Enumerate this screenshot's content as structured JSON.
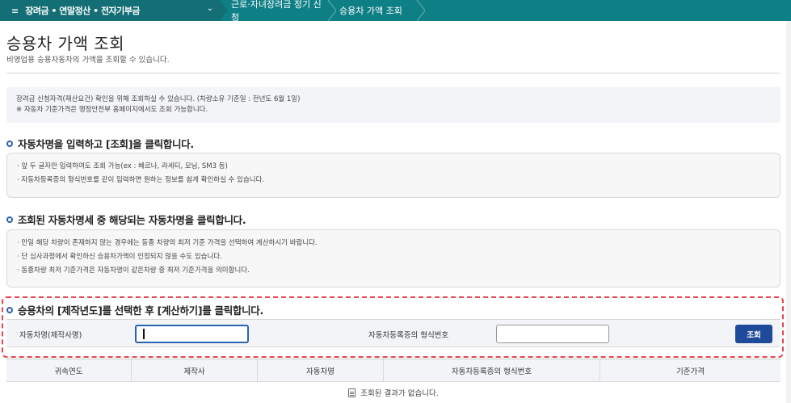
{
  "nav": {
    "menu_title": "장려금 • 연말정산 • 전자기부금",
    "menu_icon": "≡",
    "chevron": "⌄",
    "breadcrumbs": [
      "근로·자녀장려금 정기 신청",
      "승용차 가액 조회"
    ]
  },
  "header": {
    "title": "승용차 가액 조회",
    "subtitle": "비영업용 승용자동차의 가액을 조회할 수 있습니다."
  },
  "info": {
    "line1": "장려금 신청자격(재산요건) 확인을 위해 조회하실 수 있습니다. (차량소유 기준일 : 전년도 6월 1일)",
    "line2": "※ 자동차 기준가격은 행정안전부 홈페이지에서도 조회 가능합니다."
  },
  "step1": {
    "heading": "자동차명을 입력하고 [조회]을 클릭합니다.",
    "lines": [
      "· 앞 두 글자만 입력하여도 조회 가능(ex : 베르나, 라세티, 모닝, SM3 등)",
      "· 자동차등록증의 형식번호를 같이 입력하면 원하는 정보를 쉽게 확인하실 수 있습니다."
    ]
  },
  "step2": {
    "heading": "조회된 자동차명세 중 해당되는 자동차명을 클릭합니다.",
    "lines": [
      "· 만일 해당 차량이 존재하지 않는 경우에는 동종 차량의 최저 기준 가격을 선택하여 계산하시기 바랍니다.",
      "· 단 심사과정에서 확인하신 승용차가액이 인정되지 않을 수도 있습니다.",
      "· 동종차량 최저 기준가격은 자동차명이 같은차량 중  최저 기준가격을 의미합니다."
    ]
  },
  "step3": {
    "heading": "승용차의 [제작년도]를 선택한 후 [계산하기]를 클릭합니다."
  },
  "search": {
    "car_name_label": "자동차명(제작사명)",
    "car_name_value": "",
    "model_no_label": "자동차등록증의 형식번호",
    "model_no_value": "",
    "button_label": "조회"
  },
  "table": {
    "columns": [
      "귀속연도",
      "제작사",
      "자동차명",
      "자동차등록증의 형식번호",
      "기준가격"
    ],
    "empty_message": "조회된 결과가 없습니다."
  },
  "colors": {
    "nav_bg": "#0f7f86",
    "primary_button": "#1f4a99",
    "highlight_border": "#e4474f"
  }
}
